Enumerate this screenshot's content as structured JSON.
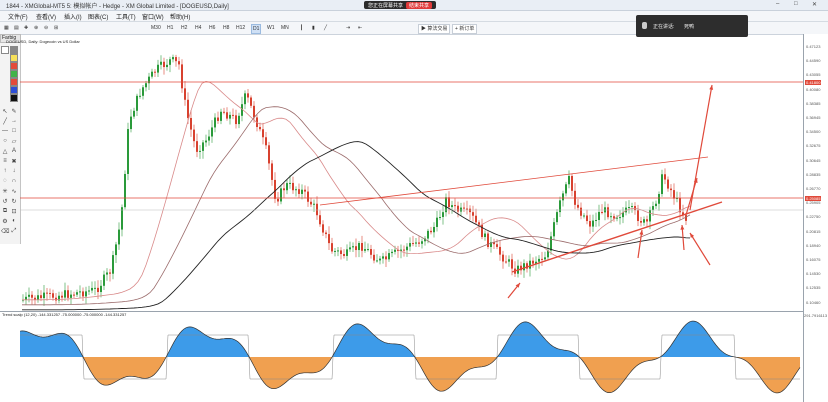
{
  "window": {
    "title": "1844 - XMGlobal-MT5 5: 模拟帐户 - Hedge - XM Global Limited - [DOGEUSD,Daily]",
    "minimize": "–",
    "maximize": "□",
    "close": "✕"
  },
  "recording": {
    "text": "您正在屏幕共享",
    "stop": "结束共享"
  },
  "menu": [
    "文件(F)",
    "查看(V)",
    "插入(I)",
    "图表(C)",
    "工具(T)",
    "窗口(W)",
    "帮助(H)"
  ],
  "timeframes": [
    "M30",
    "H1",
    "H2",
    "H4",
    "H6",
    "H8",
    "H12",
    "D1",
    "W1",
    "MN"
  ],
  "active_timeframe": "D1",
  "toolbar_buttons": {
    "algo": "算法交易",
    "new_order": "新订单"
  },
  "notification": {
    "line1": "正在讲话:",
    "line2": "死鸭"
  },
  "left_panel": {
    "tab": "Farbig"
  },
  "chart": {
    "symbol_label": "DOGEUSD, Daily: Dogecoin vs US Dollar",
    "indicator_label": "Trend scalp (12,20) -144.331257 -75.000000 -75.000000 -144.331257",
    "indicator_value": "291.7916113",
    "colors": {
      "bull": "#2a9a3a",
      "bear": "#d8412f",
      "level": "#e0493a",
      "ma1": "#d98a8a",
      "ma2": "#9b6b6b",
      "ma3": "#222222",
      "osc_up": "#3d9be9",
      "osc_down": "#f0a050"
    }
  },
  "price_axis": {
    "labels": [
      "0.47123",
      "0.44590",
      "0.43055",
      "0.40080",
      "0.38385",
      "0.36945",
      "0.34500",
      "0.32675",
      "0.30645",
      "0.28835",
      "0.26770",
      "0.25905",
      "0.22750",
      "0.20815",
      "0.18940",
      "0.16075",
      "0.14530",
      "0.12535",
      "0.10460"
    ],
    "tag_top": "0.41800",
    "tag_current": "0.25085"
  }
}
